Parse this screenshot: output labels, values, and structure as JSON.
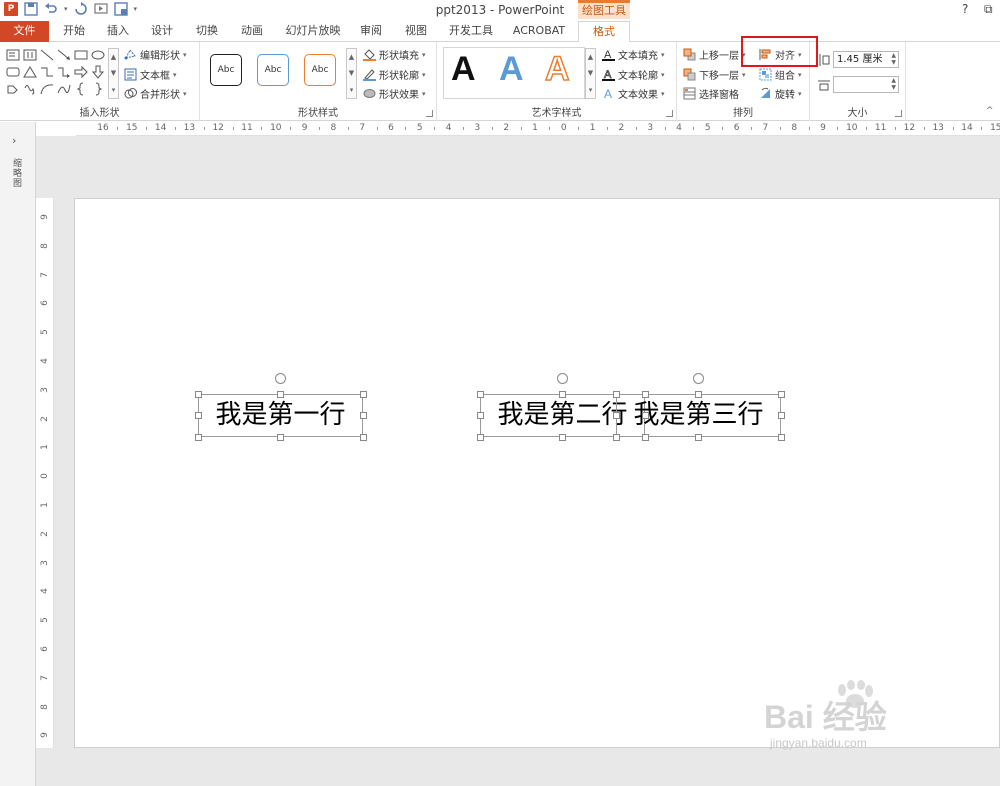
{
  "window": {
    "title": "ppt2013 - PowerPoint",
    "context_tab_title": "绘图工具",
    "help": "?",
    "restore": "⧉"
  },
  "tabs": [
    {
      "label": "文件"
    },
    {
      "label": "开始"
    },
    {
      "label": "插入"
    },
    {
      "label": "设计"
    },
    {
      "label": "切换"
    },
    {
      "label": "动画"
    },
    {
      "label": "幻灯片放映"
    },
    {
      "label": "审阅"
    },
    {
      "label": "视图"
    },
    {
      "label": "开发工具"
    },
    {
      "label": "ACROBAT"
    },
    {
      "label": "格式"
    }
  ],
  "ribbon": {
    "insert_shapes": {
      "label": "插入形状",
      "edit_shape": "编辑形状",
      "text_box": "文本框",
      "merge_shapes": "合并形状"
    },
    "shape_styles": {
      "label": "形状样式",
      "styles": [
        "Abc",
        "Abc",
        "Abc"
      ],
      "fill": "形状填充",
      "outline": "形状轮廓",
      "effects": "形状效果"
    },
    "wordart": {
      "label": "艺术字样式",
      "letters": [
        "A",
        "A",
        "A"
      ],
      "text_fill": "文本填充",
      "text_outline": "文本轮廓",
      "text_effects": "文本效果"
    },
    "arrange": {
      "label": "排列",
      "bring_forward": "上移一层",
      "send_backward": "下移一层",
      "selection_pane": "选择窗格",
      "align": "对齐",
      "group": "组合",
      "rotate": "旋转"
    },
    "size": {
      "label": "大小",
      "height": "1.45 厘米",
      "width": ""
    }
  },
  "left_panel": {
    "label": "缩略图"
  },
  "ruler": {
    "horizontal": [
      "16",
      "15",
      "14",
      "13",
      "12",
      "11",
      "10",
      "9",
      "8",
      "7",
      "6",
      "5",
      "4",
      "3",
      "2",
      "1",
      "0",
      "1",
      "2",
      "3",
      "4",
      "5",
      "6",
      "7",
      "8",
      "9",
      "10",
      "11",
      "12",
      "13",
      "14",
      "15"
    ],
    "vertical": [
      "9",
      "8",
      "7",
      "6",
      "5",
      "4",
      "3",
      "2",
      "1",
      "0",
      "1",
      "2",
      "3",
      "4",
      "5",
      "6",
      "7",
      "8",
      "9"
    ]
  },
  "slide": {
    "textboxes": [
      {
        "text": "我是第一行"
      },
      {
        "text": "我是第二行"
      },
      {
        "text": "我是第三行"
      }
    ]
  },
  "watermark": {
    "main": "Bai 经验",
    "sub": "jingyan.baidu.com"
  },
  "colors": {
    "accent": "#d24726",
    "context": "#c55a11",
    "highlight": "#e0181b"
  }
}
